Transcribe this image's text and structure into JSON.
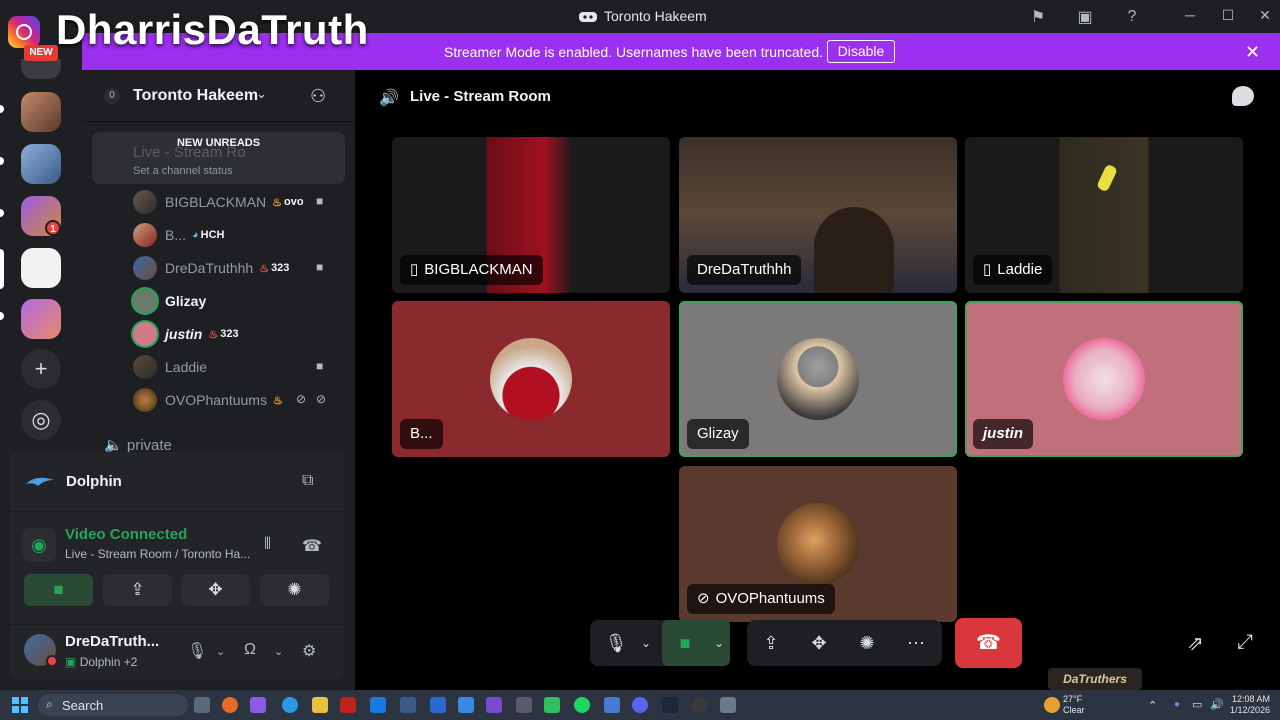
{
  "window": {
    "title": "Toronto Hakeem"
  },
  "overlay": {
    "watermark": "DharrisDaTruth",
    "new_badge": "NEW",
    "corner_logo": "DaTruthers"
  },
  "banner": {
    "message": "Streamer Mode is enabled. Usernames have been truncated.",
    "disable_label": "Disable",
    "color": "#9b30f0"
  },
  "server": {
    "name": "Toronto Hakeem",
    "unreads_label": "NEW UNREADS",
    "ghost_channel": "Live - Stream Ro",
    "channel_status": "Set a channel status",
    "private_channel": "private",
    "server_badge_count": "1"
  },
  "members": [
    {
      "name": "BIGBLACKMAN",
      "badge": "ovo",
      "badge_icon": "flame",
      "camera": true,
      "bright": false
    },
    {
      "name": "B...",
      "badge": "HCH",
      "badge_icon": "drop",
      "camera": false,
      "bright": false
    },
    {
      "name": "DreDaTruthhh",
      "badge": "323",
      "badge_icon": "flame",
      "camera": true,
      "bright": false
    },
    {
      "name": "Glizay",
      "badge": "",
      "badge_icon": "",
      "camera": false,
      "bright": true
    },
    {
      "name": "justin",
      "badge": "323",
      "badge_icon": "flame",
      "camera": false,
      "bright": true
    },
    {
      "name": "Laddie",
      "badge": "",
      "badge_icon": "",
      "camera": true,
      "bright": false
    },
    {
      "name": "OVOPhantuums",
      "badge": "",
      "badge_icon": "flame",
      "camera": false,
      "bright": false
    }
  ],
  "activity": {
    "name": "Dolphin"
  },
  "voice": {
    "status": "Video Connected",
    "location": "Live - Stream Room / Toronto Ha..."
  },
  "user": {
    "name": "DreDaTruth...",
    "activity": "Dolphin +2"
  },
  "stage": {
    "channel_name": "Live - Stream Room"
  },
  "tiles": [
    {
      "name": "BIGBLACKMAN",
      "mobile": true
    },
    {
      "name": "DreDaTruthhh",
      "mobile": false
    },
    {
      "name": "Laddie",
      "mobile": true
    },
    {
      "name": "B...",
      "mobile": false
    },
    {
      "name": "Glizay",
      "mobile": false
    },
    {
      "name": "justin",
      "mobile": false
    },
    {
      "name": "OVOPhantuums",
      "mobile": false
    }
  ],
  "taskbar": {
    "search_placeholder": "Search",
    "weather_temp": "27°F",
    "weather_desc": "Clear",
    "time": "12:08 AM",
    "date": "1/12/2026"
  },
  "colors": {
    "accent_green": "#23a55a",
    "hangup_red": "#da373c",
    "discord_bg": "#1e1f22"
  }
}
